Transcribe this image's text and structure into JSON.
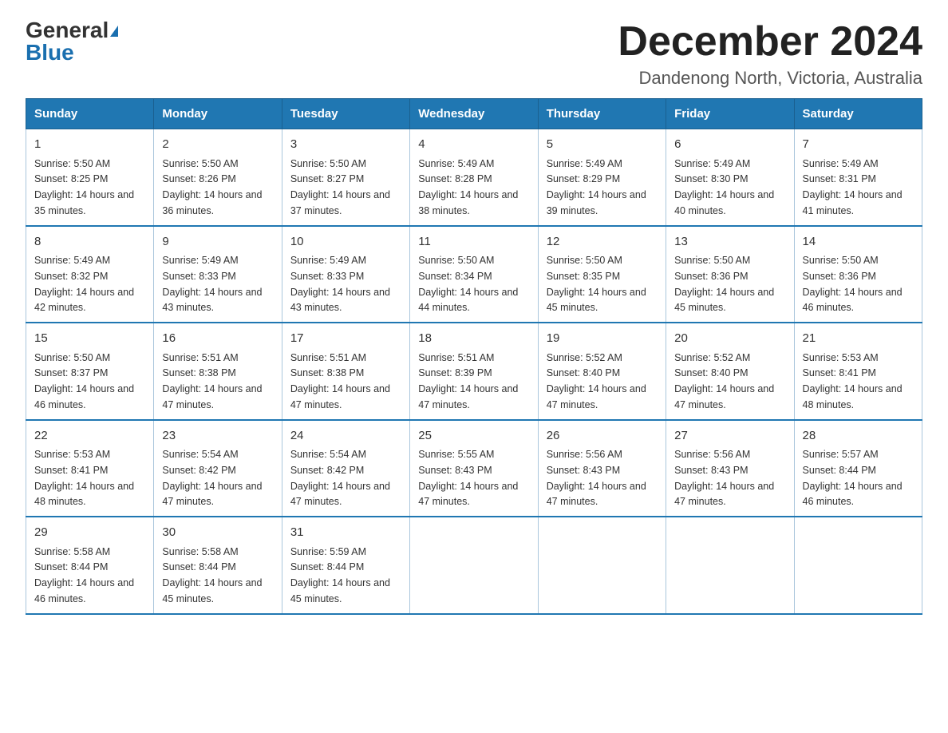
{
  "logo": {
    "general": "General",
    "blue": "Blue"
  },
  "title": "December 2024",
  "subtitle": "Dandenong North, Victoria, Australia",
  "days_header": [
    "Sunday",
    "Monday",
    "Tuesday",
    "Wednesday",
    "Thursday",
    "Friday",
    "Saturday"
  ],
  "weeks": [
    [
      {
        "day": "1",
        "sunrise": "5:50 AM",
        "sunset": "8:25 PM",
        "daylight": "14 hours and 35 minutes."
      },
      {
        "day": "2",
        "sunrise": "5:50 AM",
        "sunset": "8:26 PM",
        "daylight": "14 hours and 36 minutes."
      },
      {
        "day": "3",
        "sunrise": "5:50 AM",
        "sunset": "8:27 PM",
        "daylight": "14 hours and 37 minutes."
      },
      {
        "day": "4",
        "sunrise": "5:49 AM",
        "sunset": "8:28 PM",
        "daylight": "14 hours and 38 minutes."
      },
      {
        "day": "5",
        "sunrise": "5:49 AM",
        "sunset": "8:29 PM",
        "daylight": "14 hours and 39 minutes."
      },
      {
        "day": "6",
        "sunrise": "5:49 AM",
        "sunset": "8:30 PM",
        "daylight": "14 hours and 40 minutes."
      },
      {
        "day": "7",
        "sunrise": "5:49 AM",
        "sunset": "8:31 PM",
        "daylight": "14 hours and 41 minutes."
      }
    ],
    [
      {
        "day": "8",
        "sunrise": "5:49 AM",
        "sunset": "8:32 PM",
        "daylight": "14 hours and 42 minutes."
      },
      {
        "day": "9",
        "sunrise": "5:49 AM",
        "sunset": "8:33 PM",
        "daylight": "14 hours and 43 minutes."
      },
      {
        "day": "10",
        "sunrise": "5:49 AM",
        "sunset": "8:33 PM",
        "daylight": "14 hours and 43 minutes."
      },
      {
        "day": "11",
        "sunrise": "5:50 AM",
        "sunset": "8:34 PM",
        "daylight": "14 hours and 44 minutes."
      },
      {
        "day": "12",
        "sunrise": "5:50 AM",
        "sunset": "8:35 PM",
        "daylight": "14 hours and 45 minutes."
      },
      {
        "day": "13",
        "sunrise": "5:50 AM",
        "sunset": "8:36 PM",
        "daylight": "14 hours and 45 minutes."
      },
      {
        "day": "14",
        "sunrise": "5:50 AM",
        "sunset": "8:36 PM",
        "daylight": "14 hours and 46 minutes."
      }
    ],
    [
      {
        "day": "15",
        "sunrise": "5:50 AM",
        "sunset": "8:37 PM",
        "daylight": "14 hours and 46 minutes."
      },
      {
        "day": "16",
        "sunrise": "5:51 AM",
        "sunset": "8:38 PM",
        "daylight": "14 hours and 47 minutes."
      },
      {
        "day": "17",
        "sunrise": "5:51 AM",
        "sunset": "8:38 PM",
        "daylight": "14 hours and 47 minutes."
      },
      {
        "day": "18",
        "sunrise": "5:51 AM",
        "sunset": "8:39 PM",
        "daylight": "14 hours and 47 minutes."
      },
      {
        "day": "19",
        "sunrise": "5:52 AM",
        "sunset": "8:40 PM",
        "daylight": "14 hours and 47 minutes."
      },
      {
        "day": "20",
        "sunrise": "5:52 AM",
        "sunset": "8:40 PM",
        "daylight": "14 hours and 47 minutes."
      },
      {
        "day": "21",
        "sunrise": "5:53 AM",
        "sunset": "8:41 PM",
        "daylight": "14 hours and 48 minutes."
      }
    ],
    [
      {
        "day": "22",
        "sunrise": "5:53 AM",
        "sunset": "8:41 PM",
        "daylight": "14 hours and 48 minutes."
      },
      {
        "day": "23",
        "sunrise": "5:54 AM",
        "sunset": "8:42 PM",
        "daylight": "14 hours and 47 minutes."
      },
      {
        "day": "24",
        "sunrise": "5:54 AM",
        "sunset": "8:42 PM",
        "daylight": "14 hours and 47 minutes."
      },
      {
        "day": "25",
        "sunrise": "5:55 AM",
        "sunset": "8:43 PM",
        "daylight": "14 hours and 47 minutes."
      },
      {
        "day": "26",
        "sunrise": "5:56 AM",
        "sunset": "8:43 PM",
        "daylight": "14 hours and 47 minutes."
      },
      {
        "day": "27",
        "sunrise": "5:56 AM",
        "sunset": "8:43 PM",
        "daylight": "14 hours and 47 minutes."
      },
      {
        "day": "28",
        "sunrise": "5:57 AM",
        "sunset": "8:44 PM",
        "daylight": "14 hours and 46 minutes."
      }
    ],
    [
      {
        "day": "29",
        "sunrise": "5:58 AM",
        "sunset": "8:44 PM",
        "daylight": "14 hours and 46 minutes."
      },
      {
        "day": "30",
        "sunrise": "5:58 AM",
        "sunset": "8:44 PM",
        "daylight": "14 hours and 45 minutes."
      },
      {
        "day": "31",
        "sunrise": "5:59 AM",
        "sunset": "8:44 PM",
        "daylight": "14 hours and 45 minutes."
      },
      null,
      null,
      null,
      null
    ]
  ],
  "labels": {
    "sunrise": "Sunrise:",
    "sunset": "Sunset:",
    "daylight": "Daylight:"
  }
}
